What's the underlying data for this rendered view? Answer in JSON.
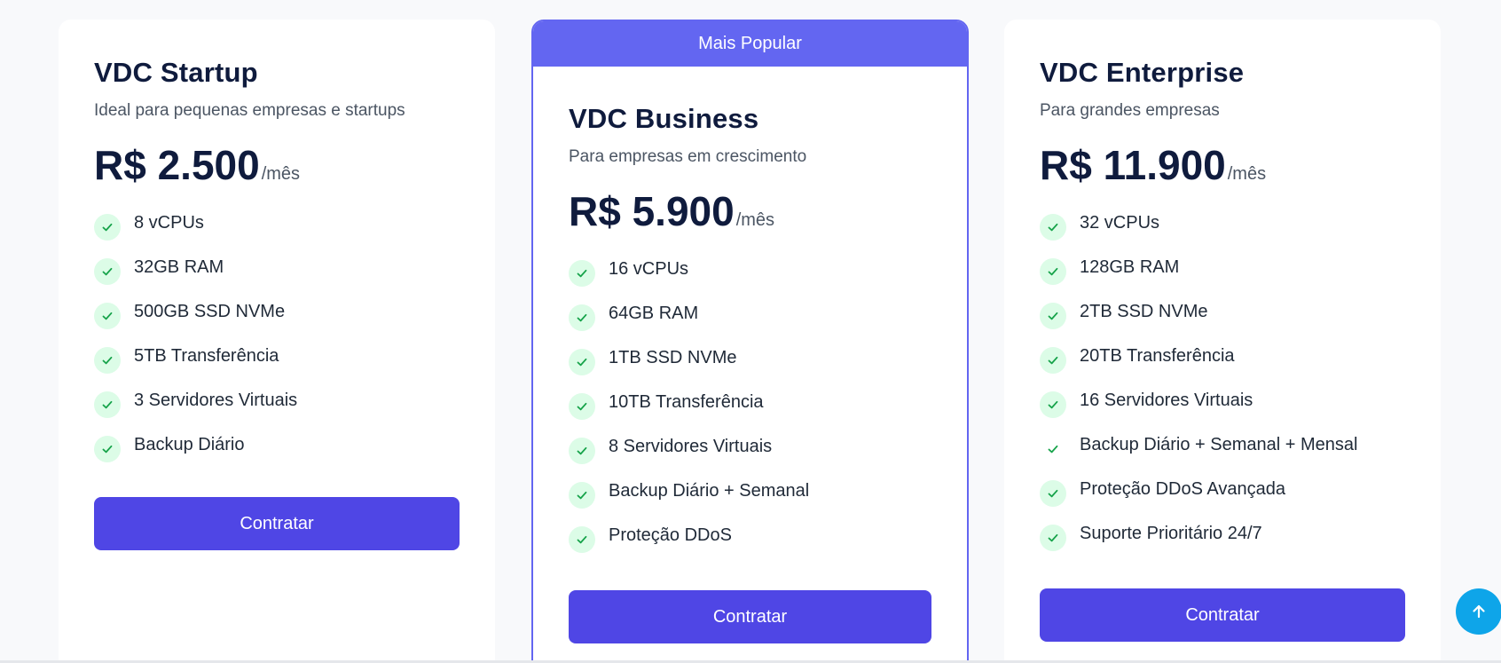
{
  "plans": [
    {
      "name": "VDC Startup",
      "description": "Ideal para pequenas empresas e startups",
      "price": "R$ 2.500",
      "period": "/mês",
      "features": [
        "8 vCPUs",
        "32GB RAM",
        "500GB SSD NVMe",
        "5TB Transferência",
        "3 Servidores Virtuais",
        "Backup Diário"
      ],
      "cta": "Contratar"
    },
    {
      "badge": "Mais Popular",
      "name": "VDC Business",
      "description": "Para empresas em crescimento",
      "price": "R$ 5.900",
      "period": "/mês",
      "features": [
        "16 vCPUs",
        "64GB RAM",
        "1TB SSD NVMe",
        "10TB Transferência",
        "8 Servidores Virtuais",
        "Backup Diário + Semanal",
        "Proteção DDoS"
      ],
      "cta": "Contratar"
    },
    {
      "name": "VDC Enterprise",
      "description": "Para grandes empresas",
      "price": "R$ 11.900",
      "period": "/mês",
      "features": [
        "32 vCPUs",
        "128GB RAM",
        "2TB SSD NVMe",
        "20TB Transferência",
        "16 Servidores Virtuais",
        "Backup Diário + Semanal + Mensal",
        "Proteção DDoS Avançada",
        "Suporte Prioritário 24/7"
      ],
      "cta": "Contratar"
    }
  ],
  "icons": {
    "feature": "check-icon",
    "scroll_top": "arrow-up-icon"
  },
  "colors": {
    "accent": "#4f46e5",
    "popular_border": "#6366f1",
    "check_bg": "#dcfce7",
    "check_fg": "#16a34a",
    "scroll_top_bg": "#0ea5e9"
  }
}
